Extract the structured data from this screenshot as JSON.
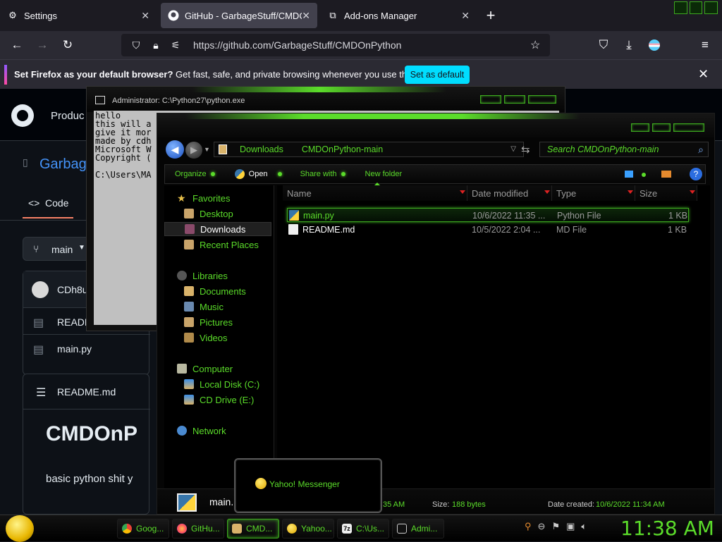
{
  "browser": {
    "tabs": [
      {
        "label": "Settings",
        "icon": "gear-icon"
      },
      {
        "label": "GitHub - GarbageStuff/CMDOn",
        "icon": "github-icon"
      },
      {
        "label": "Add-ons Manager",
        "icon": "puzzle-icon"
      }
    ],
    "new_tab_label": "+",
    "url": "https://github.com/GarbageStuff/CMDOnPython",
    "infobar": {
      "bold": "Set Firefox as your default browser?",
      "text": " Get fast, safe, and private browsing whenever you use the web.",
      "button": "Set as default"
    }
  },
  "github": {
    "nav_item": "Produc",
    "repo_partial": "Garbage",
    "tab_code": "Code",
    "branch": "main",
    "commit_author": "CDh8u",
    "files": [
      "READM",
      "main.py"
    ],
    "readme_header": "README.md",
    "readme_title": "CMDOnP",
    "readme_body": "basic python shit y"
  },
  "cmd": {
    "title": "Administrator: C:\\Python27\\python.exe",
    "console_text": "hello\nthis will a\ngive it mor\nmade by cdh\nMicrosoft W\nCopyright (\n\nC:\\Users\\MA"
  },
  "explorer": {
    "breadcrumb": [
      "Downloads",
      "CMDOnPython-main"
    ],
    "search_placeholder": "Search CMDOnPython-main",
    "commands": {
      "organize": "Organize",
      "open": "Open",
      "share": "Share with",
      "new_folder": "New folder"
    },
    "nav": {
      "favorites": "Favorites",
      "desktop": "Desktop",
      "downloads": "Downloads",
      "recent": "Recent Places",
      "libraries": "Libraries",
      "documents": "Documents",
      "music": "Music",
      "pictures": "Pictures",
      "videos": "Videos",
      "computer": "Computer",
      "local_disk": "Local Disk (C:)",
      "cd_drive": "CD Drive (E:)",
      "network": "Network"
    },
    "columns": [
      "Name",
      "Date modified",
      "Type",
      "Size"
    ],
    "files": [
      {
        "name": "main.py",
        "date": "10/6/2022 11:35 ...",
        "type": "Python File",
        "size": "1 KB"
      },
      {
        "name": "README.md",
        "date": "10/5/2022 2:04 ...",
        "type": "MD File",
        "size": "1 KB"
      }
    ],
    "status": {
      "name": "main.",
      "time_partial": "35 AM",
      "size_label": "Size:",
      "size_value": "188 bytes",
      "created_label": "Date created:",
      "created_value": "10/6/2022 11:34 AM"
    }
  },
  "yahoo_popup": "Yahoo! Messenger",
  "taskbar": {
    "items": [
      "Goog...",
      "GitHu...",
      "CMD...",
      "Yahoo...",
      "C:\\Us...",
      "Admi..."
    ],
    "clock": "11:38 AM"
  },
  "colors": {
    "accent_green": "#5bdc2a",
    "firefox_cyan": "#00ddff",
    "github_bg": "#0d1117"
  }
}
